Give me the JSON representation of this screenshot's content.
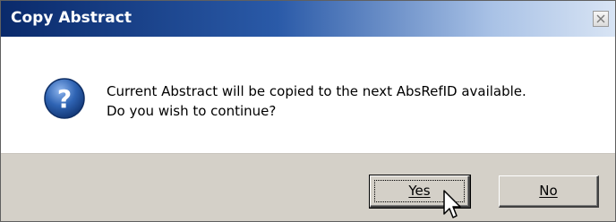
{
  "dialog": {
    "title": "Copy Abstract",
    "close_icon": "close-icon",
    "message_lines": [
      "Current Abstract will be copied to the next AbsRefID available.",
      "Do you wish to continue?"
    ],
    "icon": "question-icon",
    "buttons": {
      "yes_label": "Yes",
      "no_label": "No"
    }
  },
  "colors": {
    "title_start": "#0a2a6b",
    "title_end": "#d8e4f4",
    "button_face": "#d4d0c8",
    "icon_blue": "#2f64b4"
  }
}
